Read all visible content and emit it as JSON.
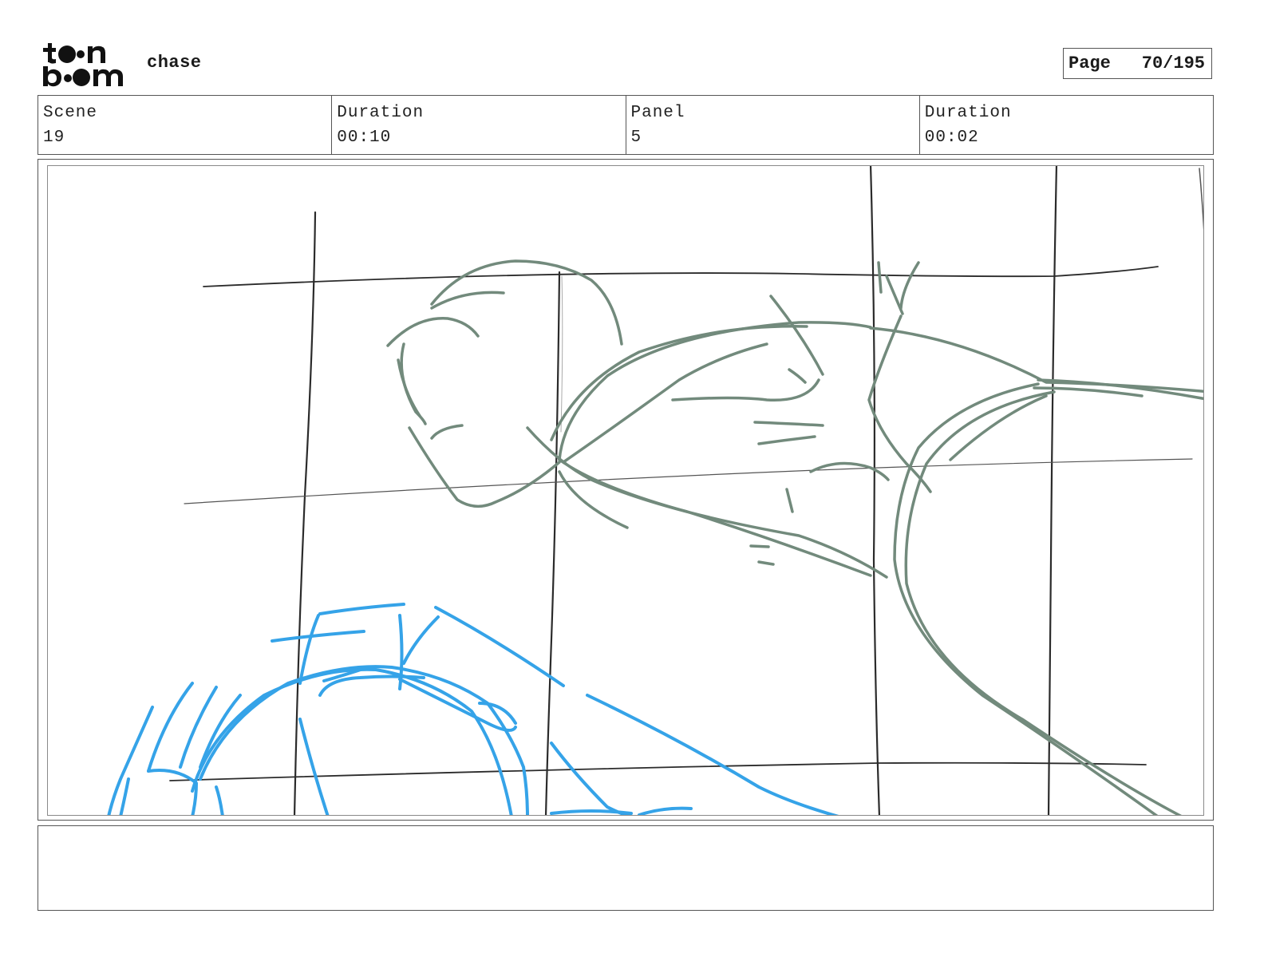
{
  "header": {
    "logo_text": "toon boom",
    "project_title": "chase",
    "page_label": "Page",
    "page_value": "70/195"
  },
  "info": {
    "scene_label": "Scene",
    "scene_value": "19",
    "scene_duration_label": "Duration",
    "scene_duration_value": "00:10",
    "panel_label": "Panel",
    "panel_value": "5",
    "panel_duration_label": "Duration",
    "panel_duration_value": "00:02"
  },
  "panel": {
    "sketch_colors": {
      "guide_lines": "#2b2b2b",
      "character": "#728a7c",
      "foreground": "#35a3e8"
    }
  },
  "notes": {
    "text": ""
  }
}
